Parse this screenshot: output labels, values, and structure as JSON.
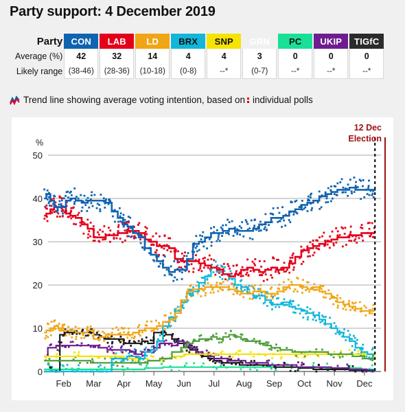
{
  "header": {
    "title": "Party support: 4 December 2019"
  },
  "table": {
    "row_labels": {
      "party": "Party",
      "average": "Average (%)",
      "range": "Likely range"
    },
    "parties": [
      {
        "code": "CON",
        "color": "#1063b0",
        "text_color": "#ffffff",
        "average": "42",
        "range": "(38-46)"
      },
      {
        "code": "LAB",
        "color": "#e4001b",
        "text_color": "#ffffff",
        "average": "32",
        "range": "(28-36)"
      },
      {
        "code": "LD",
        "color": "#f0a515",
        "text_color": "#ffffff",
        "average": "14",
        "range": "(10-18)"
      },
      {
        "code": "BRX",
        "color": "#12b6d8",
        "text_color": "#111111",
        "average": "4",
        "range": "(0-8)"
      },
      {
        "code": "SNP",
        "color": "#f5e302",
        "text_color": "#111111",
        "average": "4",
        "range": "--*"
      },
      {
        "code": "GRN",
        "color": "#56a councils",
        "text_color": "#ffffff",
        "average": "3",
        "range": "(0-7)"
      },
      {
        "code": "PC",
        "color": "#19e096",
        "text_color": "#111111",
        "average": "0",
        "range": "--*"
      },
      {
        "code": "UKIP",
        "color": "#6d1d8f",
        "text_color": "#ffffff",
        "average": "0",
        "range": "--*"
      },
      {
        "code": "TIGfC",
        "color": "#2b2b2b",
        "text_color": "#ffffff",
        "average": "0",
        "range": "--*"
      }
    ]
  },
  "legend": {
    "text_before": "Trend line showing average voting intention, based on",
    "text_after": "individual polls",
    "trend_icon": "trend-line-icon",
    "poll_icon": "poll-dots-icon"
  },
  "annotation": {
    "date": "12 Dec",
    "label": "Election",
    "color": "#9c1111"
  },
  "chart_data": {
    "type": "line",
    "title": "Party support: 4 December 2019",
    "xlabel": "",
    "ylabel": "%",
    "ylim": [
      0,
      50
    ],
    "yticks": [
      0,
      10,
      20,
      30,
      40,
      50
    ],
    "grid": true,
    "legend_position": "none",
    "x_tick_labels": [
      "Feb",
      "Mar",
      "Apr",
      "May",
      "Jun",
      "Jul",
      "Aug",
      "Sep",
      "Oct",
      "Nov",
      "Dec"
    ],
    "x_tick_positions": [
      1,
      2,
      3,
      4,
      5,
      6,
      7,
      8,
      9,
      10,
      11
    ],
    "xlim": [
      0.3,
      11.55
    ],
    "election_marker": {
      "x": 11.35,
      "date": "12 Dec",
      "label": "Election"
    },
    "series": [
      {
        "name": "CON",
        "color": "#1063b0",
        "x": [
          0.35,
          0.5,
          0.62,
          0.75,
          0.9,
          1.0,
          1.15,
          1.3,
          1.5,
          1.7,
          1.9,
          2.1,
          2.3,
          2.5,
          2.7,
          2.9,
          3.05,
          3.2,
          3.4,
          3.6,
          3.8,
          4.0,
          4.2,
          4.4,
          4.6,
          4.8,
          5.0,
          5.2,
          5.4,
          5.6,
          5.8,
          6.0,
          6.2,
          6.4,
          6.6,
          6.8,
          7.0,
          7.2,
          7.4,
          7.6,
          7.8,
          8.0,
          8.2,
          8.4,
          8.6,
          8.8,
          9.0,
          9.2,
          9.4,
          9.6,
          9.8,
          10.0,
          10.2,
          10.4,
          10.6,
          10.8,
          11.0,
          11.2,
          11.35
        ],
        "values": [
          40.0,
          41.0,
          39.5,
          38.0,
          38.0,
          38.0,
          39.5,
          40.0,
          39.5,
          39.0,
          39.5,
          39.5,
          39.5,
          39.0,
          37.0,
          35.5,
          34.0,
          33.5,
          32.0,
          31.0,
          28.5,
          27.0,
          25.5,
          24.0,
          23.0,
          23.5,
          23.5,
          26.0,
          29.5,
          30.0,
          31.0,
          32.0,
          32.0,
          32.5,
          33.0,
          32.5,
          32.5,
          32.5,
          33.0,
          34.0,
          34.5,
          35.5,
          35.5,
          36.0,
          37.0,
          37.5,
          38.5,
          39.0,
          39.5,
          40.5,
          41.0,
          41.5,
          42.0,
          42.0,
          42.5,
          42.0,
          42.0,
          42.0,
          42.0
        ]
      },
      {
        "name": "LAB",
        "color": "#e4001b",
        "x": [
          0.35,
          0.5,
          0.62,
          0.75,
          0.9,
          1.0,
          1.15,
          1.3,
          1.5,
          1.7,
          1.9,
          2.1,
          2.3,
          2.5,
          2.7,
          2.9,
          3.05,
          3.2,
          3.4,
          3.6,
          3.8,
          4.0,
          4.2,
          4.4,
          4.6,
          4.8,
          5.0,
          5.2,
          5.4,
          5.6,
          5.8,
          6.0,
          6.2,
          6.4,
          6.6,
          6.8,
          7.0,
          7.2,
          7.4,
          7.6,
          7.8,
          8.0,
          8.2,
          8.4,
          8.6,
          8.8,
          9.0,
          9.2,
          9.4,
          9.6,
          9.8,
          10.0,
          10.2,
          10.4,
          10.6,
          10.8,
          11.0,
          11.2,
          11.35
        ],
        "values": [
          36.0,
          36.5,
          37.5,
          38.0,
          38.0,
          38.0,
          36.5,
          36.0,
          35.5,
          34.0,
          33.0,
          31.0,
          31.0,
          31.5,
          31.5,
          32.0,
          32.0,
          32.5,
          32.5,
          32.0,
          30.5,
          30.0,
          29.0,
          29.0,
          28.5,
          26.0,
          25.5,
          25.5,
          25.5,
          25.0,
          24.5,
          24.0,
          23.5,
          22.5,
          22.0,
          22.5,
          23.5,
          24.0,
          23.5,
          23.0,
          23.5,
          24.0,
          23.5,
          24.0,
          25.0,
          26.5,
          28.0,
          28.5,
          29.0,
          29.5,
          30.0,
          30.5,
          31.0,
          31.0,
          31.5,
          31.5,
          32.0,
          32.0,
          32.0
        ]
      },
      {
        "name": "LD",
        "color": "#f0a515",
        "x": [
          0.35,
          0.5,
          0.62,
          0.75,
          0.9,
          1.0,
          1.15,
          1.3,
          1.5,
          1.7,
          1.9,
          2.1,
          2.3,
          2.5,
          2.7,
          2.9,
          3.05,
          3.2,
          3.4,
          3.6,
          3.8,
          4.0,
          4.2,
          4.4,
          4.6,
          4.8,
          5.0,
          5.2,
          5.4,
          5.6,
          5.8,
          6.0,
          6.2,
          6.4,
          6.6,
          6.8,
          7.0,
          7.2,
          7.4,
          7.6,
          7.8,
          8.0,
          8.2,
          8.4,
          8.6,
          8.8,
          9.0,
          9.2,
          9.4,
          9.6,
          9.8,
          10.0,
          10.2,
          10.4,
          10.6,
          10.8,
          11.0,
          11.2,
          11.35
        ],
        "values": [
          9.0,
          9.5,
          10.0,
          10.5,
          10.0,
          9.5,
          9.5,
          9.5,
          9.0,
          9.0,
          9.5,
          7.5,
          8.0,
          8.5,
          8.5,
          8.5,
          8.5,
          8.5,
          9.0,
          9.5,
          10.0,
          10.0,
          10.5,
          11.5,
          12.0,
          13.5,
          16.5,
          18.5,
          19.0,
          19.0,
          19.5,
          19.5,
          19.5,
          19.5,
          19.0,
          18.5,
          18.0,
          18.0,
          18.5,
          18.5,
          18.0,
          18.0,
          18.5,
          19.5,
          20.0,
          20.0,
          19.5,
          19.0,
          19.5,
          18.5,
          18.0,
          17.0,
          16.0,
          15.5,
          15.0,
          14.5,
          14.0,
          14.0,
          14.0
        ]
      },
      {
        "name": "BRX",
        "color": "#12b6d8",
        "x": [
          0.35,
          0.8,
          1.2,
          1.6,
          2.0,
          2.4,
          2.8,
          3.0,
          3.2,
          3.4,
          3.6,
          3.8,
          4.0,
          4.2,
          4.4,
          4.6,
          4.8,
          5.0,
          5.2,
          5.4,
          5.6,
          5.8,
          6.0,
          6.2,
          6.4,
          6.6,
          6.8,
          7.0,
          7.2,
          7.4,
          7.6,
          7.8,
          8.0,
          8.2,
          8.4,
          8.6,
          8.8,
          9.0,
          9.2,
          9.4,
          9.6,
          9.8,
          10.0,
          10.2,
          10.4,
          10.6,
          10.8,
          11.0,
          11.2,
          11.35
        ],
        "values": [
          0.0,
          0.0,
          0.0,
          0.0,
          0.0,
          0.0,
          3.0,
          3.0,
          3.5,
          3.5,
          3.0,
          4.5,
          5.0,
          7.0,
          10.5,
          12.5,
          14.0,
          16.0,
          18.0,
          18.5,
          20.5,
          22.0,
          24.0,
          23.0,
          22.5,
          21.5,
          20.0,
          19.5,
          18.0,
          17.5,
          17.5,
          16.5,
          15.5,
          15.5,
          16.0,
          15.0,
          14.5,
          14.0,
          13.5,
          13.0,
          12.0,
          11.0,
          10.0,
          9.0,
          8.0,
          7.0,
          5.5,
          4.5,
          4.0,
          4.0
        ]
      },
      {
        "name": "SNP",
        "color": "#f5e302",
        "x": [
          0.35,
          1.0,
          1.6,
          2.2,
          2.8,
          3.2,
          3.6,
          4.0,
          4.4,
          4.8,
          5.2,
          5.6,
          6.0,
          6.4,
          6.8,
          7.2,
          7.6,
          8.0,
          8.4,
          8.8,
          9.2,
          9.6,
          10.0,
          10.4,
          10.8,
          11.2,
          11.35
        ],
        "values": [
          3.5,
          3.5,
          3.5,
          3.5,
          3.5,
          3.0,
          3.0,
          2.5,
          3.0,
          3.5,
          4.0,
          4.0,
          4.0,
          4.0,
          4.0,
          4.0,
          4.0,
          4.0,
          4.0,
          4.0,
          4.0,
          4.0,
          4.0,
          4.0,
          4.0,
          4.0,
          4.0
        ]
      },
      {
        "name": "GRN",
        "color": "#4f9e3f",
        "x": [
          0.35,
          1.0,
          1.6,
          2.2,
          2.8,
          3.2,
          3.6,
          4.0,
          4.4,
          4.8,
          5.0,
          5.2,
          5.4,
          5.6,
          5.8,
          6.0,
          6.2,
          6.4,
          6.6,
          6.8,
          7.0,
          7.2,
          7.4,
          7.6,
          7.8,
          8.0,
          8.4,
          8.8,
          9.2,
          9.6,
          10.0,
          10.4,
          10.8,
          11.2,
          11.35
        ],
        "values": [
          2.5,
          2.5,
          2.5,
          2.0,
          2.0,
          2.0,
          2.0,
          2.5,
          3.0,
          4.5,
          5.5,
          6.5,
          7.0,
          7.5,
          7.5,
          8.0,
          7.5,
          8.0,
          8.5,
          8.0,
          7.5,
          7.0,
          7.0,
          6.5,
          6.0,
          5.5,
          5.0,
          4.5,
          4.5,
          4.5,
          4.0,
          4.0,
          3.5,
          3.0,
          3.0
        ]
      },
      {
        "name": "PC",
        "color": "#19e096",
        "x": [
          0.35,
          1.0,
          1.6,
          2.2,
          2.8,
          3.4,
          4.0,
          4.6,
          5.2,
          5.8,
          6.4,
          7.0,
          7.6,
          8.2,
          8.8,
          9.4,
          10.0,
          10.6,
          11.2,
          11.35
        ],
        "values": [
          0.5,
          0.5,
          0.5,
          0.5,
          0.5,
          0.5,
          0.8,
          1.0,
          1.0,
          1.0,
          1.0,
          1.0,
          1.0,
          1.0,
          1.0,
          1.0,
          0.8,
          0.8,
          0.5,
          0.5
        ]
      },
      {
        "name": "UKIP",
        "color": "#6d1d8f",
        "x": [
          0.35,
          0.6,
          0.9,
          1.1,
          1.4,
          1.7,
          2.0,
          2.3,
          2.6,
          2.9,
          3.1,
          3.3,
          3.5,
          3.7,
          3.9,
          4.1,
          4.3,
          4.5,
          4.7,
          4.9,
          5.1,
          5.3,
          5.5,
          5.7,
          5.9,
          6.1,
          6.3,
          6.6,
          6.9,
          7.2,
          7.6,
          8.0,
          8.5,
          9.0,
          9.6,
          10.2,
          10.8,
          11.35
        ],
        "values": [
          3.5,
          5.5,
          6.0,
          6.0,
          6.0,
          6.0,
          6.0,
          5.5,
          5.0,
          5.0,
          5.0,
          4.5,
          4.0,
          4.5,
          5.0,
          5.5,
          6.5,
          6.5,
          6.0,
          7.0,
          6.5,
          5.5,
          4.5,
          4.0,
          3.5,
          3.0,
          3.0,
          2.5,
          2.5,
          2.0,
          2.0,
          1.5,
          1.5,
          1.0,
          1.0,
          0.8,
          0.5,
          0.3
        ]
      },
      {
        "name": "TIGfC",
        "color": "#1a1a1a",
        "x": [
          0.35,
          0.6,
          0.8,
          0.95,
          1.1,
          1.3,
          1.5,
          1.7,
          1.9,
          2.1,
          2.3,
          2.5,
          2.7,
          2.9,
          3.1,
          3.3,
          3.5,
          3.7,
          3.9,
          4.1,
          4.3,
          4.5,
          4.7,
          4.9,
          5.1,
          5.3,
          5.5,
          5.7,
          5.9,
          6.1,
          6.4,
          6.7,
          7.0,
          7.4,
          7.8,
          8.2,
          8.6,
          9.0,
          9.6,
          10.2,
          10.8,
          11.35
        ],
        "values": [
          0.0,
          0.0,
          0.0,
          8.5,
          9.0,
          9.0,
          9.0,
          9.0,
          9.0,
          8.5,
          8.0,
          7.5,
          7.5,
          7.5,
          6.5,
          6.5,
          6.5,
          7.0,
          6.5,
          9.0,
          9.0,
          8.5,
          7.5,
          6.5,
          5.5,
          5.0,
          4.0,
          3.5,
          3.0,
          2.5,
          2.0,
          2.0,
          1.5,
          1.5,
          1.5,
          1.0,
          1.0,
          0.8,
          0.5,
          0.5,
          0.3,
          0.2
        ]
      }
    ]
  }
}
